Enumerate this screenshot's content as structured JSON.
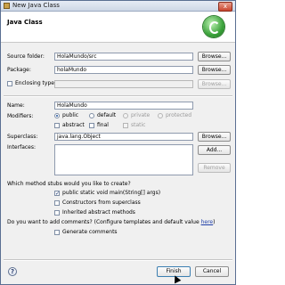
{
  "window": {
    "title": "New Java Class",
    "close_glyph": "x"
  },
  "header": {
    "title": "Java Class"
  },
  "form": {
    "source_folder": {
      "label": "Source folder:",
      "value": "HolaMundo/src",
      "button": "Browse..."
    },
    "package": {
      "label": "Package:",
      "value": "holaMundo",
      "button": "Browse..."
    },
    "enclosing": {
      "label": "Enclosing type:",
      "value": "",
      "button": "Browse..."
    },
    "name": {
      "label": "Name:",
      "value": "HolaMundo"
    },
    "modifiers": {
      "label": "Modifiers:",
      "public": "public",
      "default": "default",
      "private": "private",
      "protected": "protected",
      "abstract": "abstract",
      "final": "final",
      "static": "static"
    },
    "superclass": {
      "label": "Superclass:",
      "value": "java.lang.Object",
      "button": "Browse..."
    },
    "interfaces": {
      "label": "Interfaces:",
      "add": "Add...",
      "remove": "Remove"
    },
    "stubs": {
      "question": "Which method stubs would you like to create?",
      "main": "public static void main(String[] args)",
      "constructors": "Constructors from superclass",
      "inherited": "Inherited abstract methods"
    },
    "comments": {
      "question_prefix": "Do you want to add comments? (Configure templates and default value ",
      "link": "here",
      "question_suffix": ")",
      "generate": "Generate comments"
    }
  },
  "footer": {
    "finish": "Finish",
    "cancel": "Cancel",
    "help_glyph": "?"
  },
  "colors": {
    "accent": "#1d4f9a",
    "link": "#1f3fa8"
  }
}
